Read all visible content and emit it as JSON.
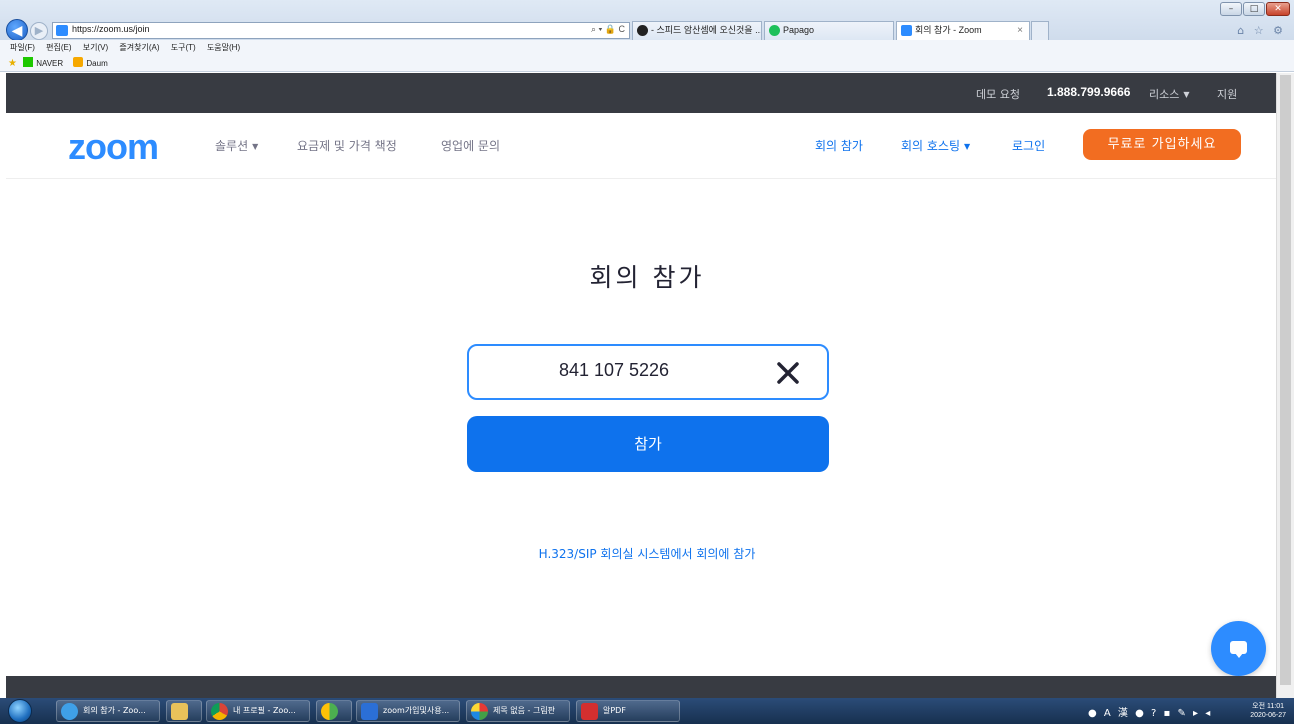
{
  "browser": {
    "url": "https://zoom.us/join",
    "addr_tools": "⌕ ▾ 🔒 C",
    "tabs": [
      {
        "label": "- 스피드 암산셈에 오신것을 ..."
      },
      {
        "label": "Papago"
      },
      {
        "label": "회의 참가 - Zoom",
        "active": true
      }
    ],
    "tab_close": "×",
    "window_controls": {
      "minimize": "–",
      "maximize": "□",
      "close": "✕"
    },
    "right_icons": "⌂ ☆ ⚙",
    "menu": [
      "파일(F)",
      "편집(E)",
      "보기(V)",
      "즐겨찾기(A)",
      "도구(T)",
      "도움말(H)"
    ],
    "favorites": [
      "NAVER",
      "Daum"
    ]
  },
  "topbar": {
    "demo": "데모 요청",
    "phone": "1.888.799.9666",
    "resources": "리소스",
    "support": "지원"
  },
  "nav": {
    "logo": "zoom",
    "solutions": "솔루션",
    "pricing": "요금제 및 가격 책정",
    "contact_sales": "영업에 문의",
    "join_meeting": "회의 참가",
    "host_meeting": "회의 호스팅",
    "sign_in": "로그인",
    "signup": "무료로 가입하세요"
  },
  "join": {
    "title": "회의 참가",
    "meeting_id": "841 107 5226",
    "join_button": "참가",
    "h323_link": "H.323/SIP 회의실 시스템에서 회의에 참가"
  },
  "taskbar": {
    "items": [
      {
        "label": "회의 참가 - Zoo..."
      },
      {
        "label": ""
      },
      {
        "label": "내 프로필 - Zoo..."
      },
      {
        "label": ""
      },
      {
        "label": "zoom가입및사용..."
      },
      {
        "label": "제목 없음 - 그림판"
      },
      {
        "label": "알PDF"
      }
    ],
    "tray_icons": "● A 漢 ● ? ▪ ✎ ▸ ◂",
    "time": "오전 11:01",
    "date": "2020-06-27"
  },
  "colors": {
    "zoom_blue": "#2d8cff",
    "button_blue": "#0e72ed",
    "signup_orange": "#f26d21",
    "topbar_dark": "#383b42"
  }
}
